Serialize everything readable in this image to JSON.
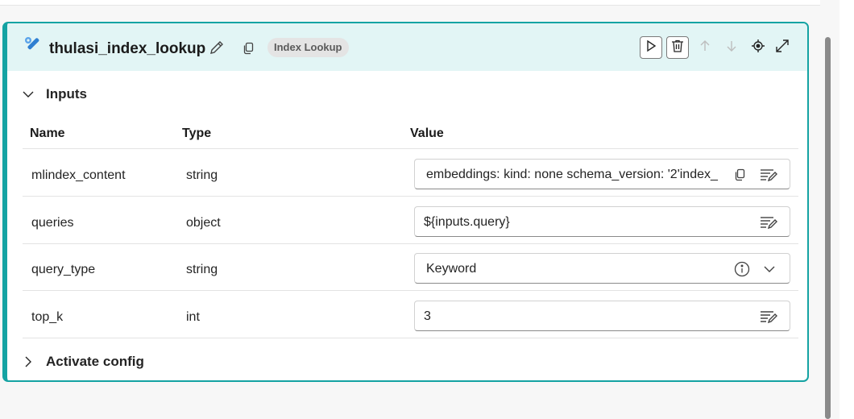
{
  "node": {
    "title": "thulasi_index_lookup",
    "badge": "Index Lookup",
    "icon": "wrench-tool-icon"
  },
  "toolbar": {
    "run": "play-icon",
    "delete": "trash-icon",
    "move_up": "arrow-up-icon",
    "move_down": "arrow-down-icon",
    "locate": "target-icon",
    "expand": "expand-icon"
  },
  "inputs": {
    "section_label": "Inputs",
    "expanded": true,
    "columns": {
      "name": "Name",
      "type": "Type",
      "value": "Value"
    },
    "rows": [
      {
        "name": "mlindex_content",
        "type": "string",
        "value": "embeddings:  kind: none  schema_version: '2'index_",
        "control": "text"
      },
      {
        "name": "queries",
        "type": "object",
        "value": "${inputs.query}",
        "control": "text"
      },
      {
        "name": "query_type",
        "type": "string",
        "value": "Keyword",
        "control": "dropdown"
      },
      {
        "name": "top_k",
        "type": "int",
        "value": "3",
        "control": "text"
      }
    ]
  },
  "activate": {
    "section_label": "Activate config",
    "expanded": false
  },
  "colors": {
    "accent": "#14a3a3",
    "header_bg": "#e2f5f5",
    "icon_blue": "#2f7fd1"
  }
}
